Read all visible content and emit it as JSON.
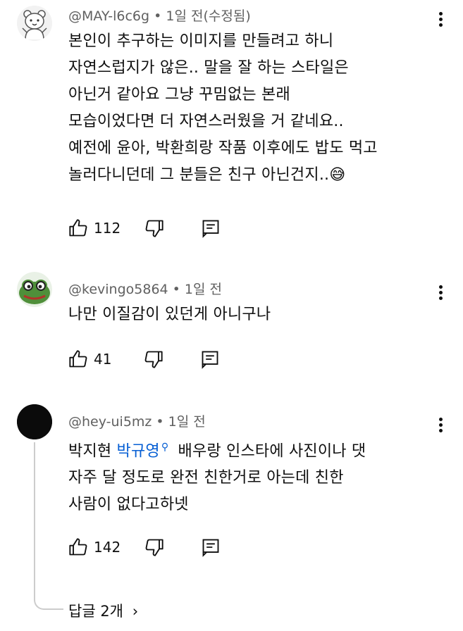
{
  "comments": [
    {
      "author": "@MAY-l6c6g",
      "meta_suffix": " • 1일 전(수정됨)",
      "lines": [
        "본인이 추구하는 이미지를 만들려고 하니",
        "자연스럽지가 않은.. 말을 잘 하는 스타일은",
        "아닌거 같아요 그냥 꾸밈없는 본래",
        "모습이었다면 더 자연스러웠을 거 같네요..",
        "예전에 윤아, 박환희랑 작품 이후에도 밥도 먹고",
        "놀러다니던데 그 분들은 친구 아닌건지.."
      ],
      "emoji": "😅",
      "likes": "112",
      "avatar_icon": "bear-avatar-icon"
    },
    {
      "author": "@kevingo5864",
      "meta_suffix": " • 1일 전",
      "lines": [
        "나만 이질감이 있던게 아니구나"
      ],
      "likes": "41",
      "avatar_icon": "frog-avatar-icon"
    },
    {
      "author": "@hey-ui5mz",
      "meta_suffix": " • 1일 전",
      "line1_prefix": "박지현 ",
      "mention": "박규영",
      "line1_suffix": " 배우랑 인스타에 사진이나 댓",
      "lines_rest": [
        "자주 달 정도로 완전 친한거로 아는데 친한",
        "사람이 없다고하넷"
      ],
      "likes": "142",
      "avatar_icon": "dark-avatar-icon",
      "replies_label": "답글 2개"
    }
  ],
  "icons": {
    "like": "thumb-up-icon",
    "dislike": "thumb-down-icon",
    "reply": "reply-icon",
    "more": "more-vert-icon",
    "search": "search-icon",
    "chevron": "chevron-right-icon"
  },
  "colors": {
    "meta": "#606060",
    "mention": "#065fd4",
    "text": "#0f0f0f"
  }
}
